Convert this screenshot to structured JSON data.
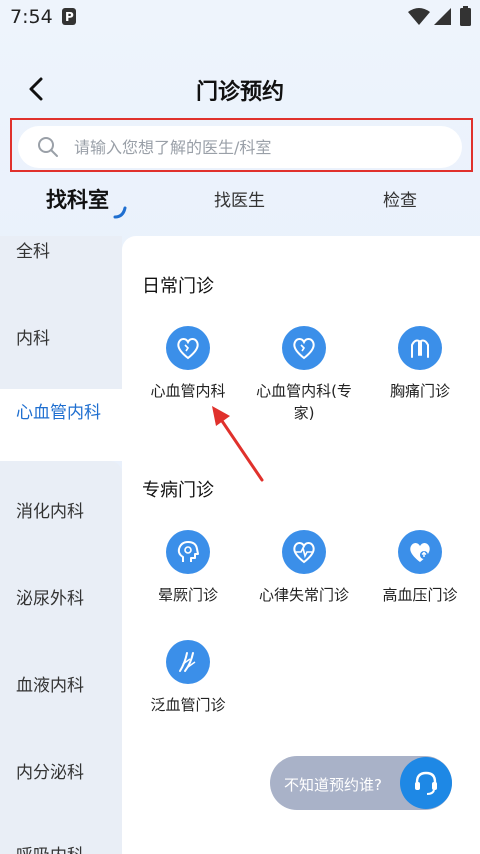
{
  "status_bar": {
    "time": "7:54"
  },
  "header": {
    "title": "门诊预约"
  },
  "search": {
    "placeholder": "请输入您想了解的医生/科室"
  },
  "tabs": [
    {
      "label": "找科室",
      "active": true
    },
    {
      "label": "找医生",
      "active": false
    },
    {
      "label": "检查",
      "active": false
    }
  ],
  "sidebar": {
    "items": [
      {
        "label": "全科"
      },
      {
        "label": "内科"
      },
      {
        "label": "心血管内科",
        "active": true
      },
      {
        "label": "消化内科"
      },
      {
        "label": "泌尿外科"
      },
      {
        "label": "血液内科"
      },
      {
        "label": "内分泌科"
      },
      {
        "label": "呼吸内科"
      }
    ]
  },
  "sections": [
    {
      "title": "日常门诊",
      "departments": [
        {
          "label": "心血管内科",
          "icon": "heart-icon"
        },
        {
          "label": "心血管内科(专家)",
          "icon": "heart-icon"
        },
        {
          "label": "胸痛门诊",
          "icon": "chest-icon"
        }
      ]
    },
    {
      "title": "专病门诊",
      "departments": [
        {
          "label": "晕厥门诊",
          "icon": "head-icon"
        },
        {
          "label": "心律失常门诊",
          "icon": "heartbeat-icon"
        },
        {
          "label": "高血压门诊",
          "icon": "heart-pressure-icon"
        },
        {
          "label": "泛血管门诊",
          "icon": "vessel-icon"
        }
      ]
    }
  ],
  "floating": {
    "label": "不知道预约谁?"
  },
  "colors": {
    "accent": "#1f6fd0",
    "icon_bg": "#3b8fe9",
    "annotation": "#e0312c"
  }
}
